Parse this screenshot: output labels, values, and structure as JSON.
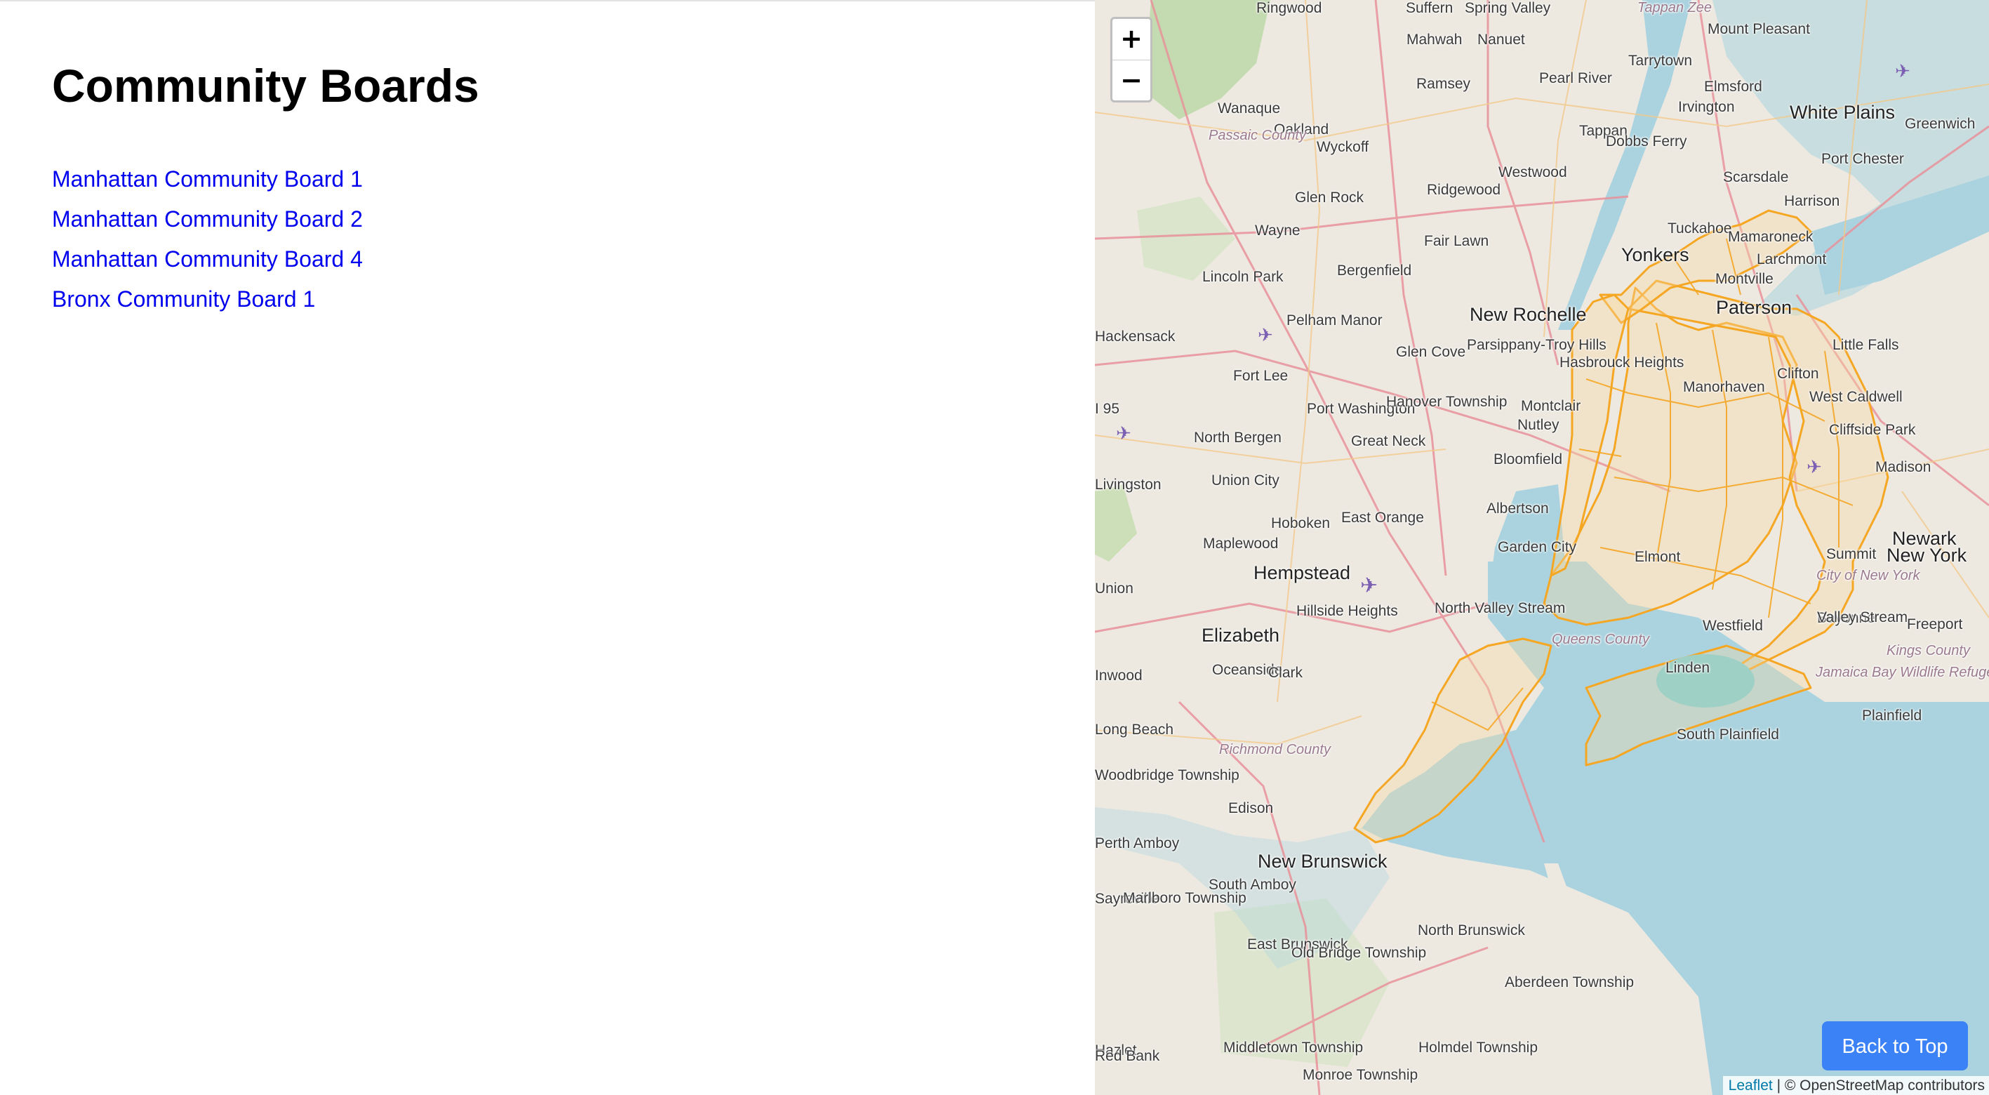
{
  "page": {
    "title": "Community Boards",
    "boards": [
      {
        "label": "Manhattan Community Board 1"
      },
      {
        "label": "Manhattan Community Board 2"
      },
      {
        "label": "Manhattan Community Board 4"
      },
      {
        "label": "Bronx Community Board 1"
      }
    ]
  },
  "map": {
    "zoom_in_label": "+",
    "zoom_out_label": "−",
    "places": [
      {
        "name": "Ringwood",
        "cls": ""
      },
      {
        "name": "Suffern",
        "cls": ""
      },
      {
        "name": "Spring Valley",
        "cls": ""
      },
      {
        "name": "Tappan Zee",
        "cls": "county"
      },
      {
        "name": "Mount Pleasant",
        "cls": ""
      },
      {
        "name": "Mahwah",
        "cls": ""
      },
      {
        "name": "Nanuet",
        "cls": ""
      },
      {
        "name": "Tarrytown",
        "cls": ""
      },
      {
        "name": "Ramsey",
        "cls": ""
      },
      {
        "name": "Pearl River",
        "cls": ""
      },
      {
        "name": "Elmsford",
        "cls": ""
      },
      {
        "name": "Wanaque",
        "cls": ""
      },
      {
        "name": "Oakland",
        "cls": ""
      },
      {
        "name": "Irvington",
        "cls": ""
      },
      {
        "name": "White Plains",
        "cls": "big"
      },
      {
        "name": "Greenwich",
        "cls": ""
      },
      {
        "name": "Passaic County",
        "cls": "county"
      },
      {
        "name": "Tappan",
        "cls": ""
      },
      {
        "name": "Wyckoff",
        "cls": ""
      },
      {
        "name": "Dobbs Ferry",
        "cls": ""
      },
      {
        "name": "Port Chester",
        "cls": ""
      },
      {
        "name": "Westwood",
        "cls": ""
      },
      {
        "name": "Scarsdale",
        "cls": ""
      },
      {
        "name": "Ridgewood",
        "cls": ""
      },
      {
        "name": "Harrison",
        "cls": ""
      },
      {
        "name": "Glen Rock",
        "cls": ""
      },
      {
        "name": "Wayne",
        "cls": ""
      },
      {
        "name": "Tuckahoe",
        "cls": ""
      },
      {
        "name": "Mamaroneck",
        "cls": ""
      },
      {
        "name": "Fair Lawn",
        "cls": ""
      },
      {
        "name": "Yonkers",
        "cls": "big"
      },
      {
        "name": "Larchmont",
        "cls": ""
      },
      {
        "name": "Lincoln Park",
        "cls": ""
      },
      {
        "name": "Bergenfield",
        "cls": ""
      },
      {
        "name": "Montville",
        "cls": ""
      },
      {
        "name": "Paterson",
        "cls": "big"
      },
      {
        "name": "New Rochelle",
        "cls": "big"
      },
      {
        "name": "Pelham Manor",
        "cls": ""
      },
      {
        "name": "Hackensack",
        "cls": ""
      },
      {
        "name": "Little Falls",
        "cls": ""
      },
      {
        "name": "Parsippany-Troy Hills",
        "cls": ""
      },
      {
        "name": "Glen Cove",
        "cls": ""
      },
      {
        "name": "Hasbrouck Heights",
        "cls": ""
      },
      {
        "name": "Clifton",
        "cls": ""
      },
      {
        "name": "Fort Lee",
        "cls": ""
      },
      {
        "name": "Manorhaven",
        "cls": ""
      },
      {
        "name": "West Caldwell",
        "cls": ""
      },
      {
        "name": "I 95",
        "cls": ""
      },
      {
        "name": "Port Washington",
        "cls": ""
      },
      {
        "name": "Hanover Township",
        "cls": ""
      },
      {
        "name": "Montclair",
        "cls": ""
      },
      {
        "name": "Nutley",
        "cls": ""
      },
      {
        "name": "Cliffside Park",
        "cls": ""
      },
      {
        "name": "North Bergen",
        "cls": ""
      },
      {
        "name": "Great Neck",
        "cls": ""
      },
      {
        "name": "Livingston",
        "cls": ""
      },
      {
        "name": "Bloomfield",
        "cls": ""
      },
      {
        "name": "Madison",
        "cls": ""
      },
      {
        "name": "Union City",
        "cls": ""
      },
      {
        "name": "Albertson",
        "cls": ""
      },
      {
        "name": "East Orange",
        "cls": ""
      },
      {
        "name": "Hoboken",
        "cls": ""
      },
      {
        "name": "Newark",
        "cls": "big"
      },
      {
        "name": "Maplewood",
        "cls": ""
      },
      {
        "name": "Garden City",
        "cls": ""
      },
      {
        "name": "Summit",
        "cls": ""
      },
      {
        "name": "New York",
        "cls": "big"
      },
      {
        "name": "Elmont",
        "cls": ""
      },
      {
        "name": "Hempstead",
        "cls": "big"
      },
      {
        "name": "City of New York",
        "cls": "county"
      },
      {
        "name": "Union",
        "cls": ""
      },
      {
        "name": "North Valley Stream",
        "cls": ""
      },
      {
        "name": "Hillside Heights",
        "cls": ""
      },
      {
        "name": "Bayonne",
        "cls": ""
      },
      {
        "name": "Elizabeth",
        "cls": "big"
      },
      {
        "name": "Valley Stream",
        "cls": ""
      },
      {
        "name": "Freeport",
        "cls": ""
      },
      {
        "name": "Westfield",
        "cls": ""
      },
      {
        "name": "Queens County",
        "cls": "county"
      },
      {
        "name": "Kings County",
        "cls": "county"
      },
      {
        "name": "Oceanside",
        "cls": ""
      },
      {
        "name": "Clark",
        "cls": ""
      },
      {
        "name": "Linden",
        "cls": ""
      },
      {
        "name": "Jamaica Bay Wildlife Refuge",
        "cls": "county"
      },
      {
        "name": "Inwood",
        "cls": ""
      },
      {
        "name": "Plainfield",
        "cls": ""
      },
      {
        "name": "Long Beach",
        "cls": ""
      },
      {
        "name": "South Plainfield",
        "cls": ""
      },
      {
        "name": "Richmond County",
        "cls": "county"
      },
      {
        "name": "Woodbridge Township",
        "cls": ""
      },
      {
        "name": "Edison",
        "cls": ""
      },
      {
        "name": "Perth Amboy",
        "cls": ""
      },
      {
        "name": "New Brunswick",
        "cls": "big"
      },
      {
        "name": "South Amboy",
        "cls": ""
      },
      {
        "name": "Sayreville",
        "cls": ""
      },
      {
        "name": "North Brunswick",
        "cls": ""
      },
      {
        "name": "Hazlet",
        "cls": ""
      },
      {
        "name": "East Brunswick",
        "cls": ""
      },
      {
        "name": "Old Bridge Township",
        "cls": ""
      },
      {
        "name": "Aberdeen Township",
        "cls": ""
      },
      {
        "name": "Middletown Township",
        "cls": ""
      },
      {
        "name": "Holmdel Township",
        "cls": ""
      },
      {
        "name": "Red Bank",
        "cls": ""
      },
      {
        "name": "Monroe Township",
        "cls": ""
      },
      {
        "name": "Marlboro Township",
        "cls": ""
      }
    ],
    "attribution_link": "Leaflet",
    "attribution_separator": "|",
    "attribution_text": "© OpenStreetMap contributors"
  },
  "back_to_top_label": "Back to Top",
  "colors": {
    "link": "#0000ee",
    "board_outline": "#f5a623",
    "water": "#aad3df",
    "button": "#3b82f6"
  }
}
